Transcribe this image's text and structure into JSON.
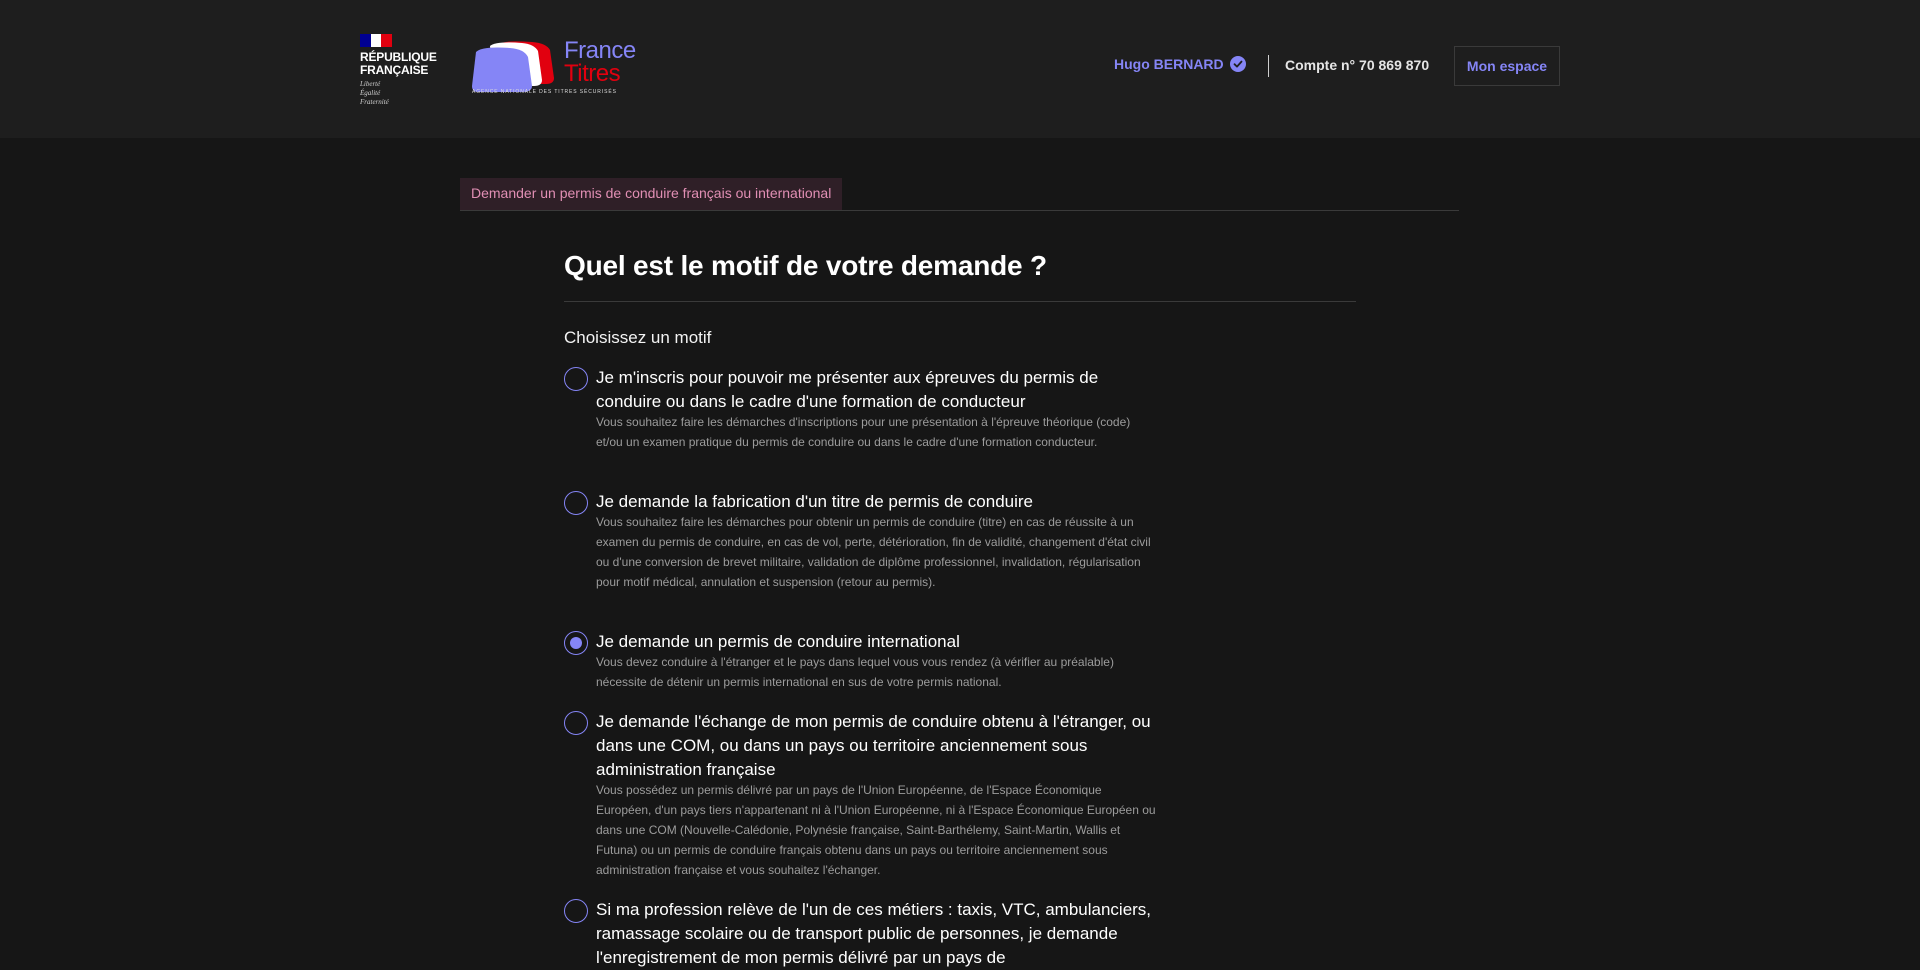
{
  "header": {
    "republique": {
      "line1": "RÉPUBLIQUE",
      "line2": "FRANÇAISE",
      "motto": [
        "Liberté",
        "Égalité",
        "Fraternité"
      ],
      "flag_colors": [
        "#000091",
        "#ffffff",
        "#e1000f"
      ]
    },
    "brand": {
      "line1": "France",
      "line2": "Titres",
      "agency": "AGENCE NATIONALE DES TITRES SÉCURISÉS"
    },
    "user_name": "Hugo BERNARD",
    "verified_icon": "check-badge-icon",
    "account": "Compte n° 70 869 870",
    "mon_espace": "Mon espace"
  },
  "breadcrumb": {
    "label": "Demander un permis de conduire français ou international"
  },
  "form": {
    "title": "Quel est le motif de votre demande ?",
    "legend": "Choisissez un motif",
    "options": [
      {
        "label": "Je m'inscris pour pouvoir me présenter aux épreuves du permis de conduire ou dans le cadre d'une formation de conducteur",
        "hint": "Vous souhaitez faire les démarches d'inscriptions pour une présentation à l'épreuve théorique (code) et/ou un examen pratique du permis de conduire ou dans le cadre d'une formation conducteur.",
        "checked": false
      },
      {
        "label": "Je demande la fabrication d'un titre de permis de conduire",
        "hint": "Vous souhaitez faire les démarches pour obtenir un permis de conduire (titre) en cas de réussite à un examen du permis de conduire, en cas de vol, perte, détérioration, fin de validité, changement d'état civil ou d'une conversion de brevet militaire, validation de diplôme professionnel, invalidation, régularisation pour motif médical, annulation et suspension (retour au permis).",
        "checked": false
      },
      {
        "label": "Je demande un permis de conduire international",
        "hint": "Vous devez conduire à l'étranger et le pays dans lequel vous vous rendez (à vérifier au préalable) nécessite de détenir un permis international en sus de votre permis national.",
        "checked": true
      },
      {
        "label": "Je demande l'échange de mon permis de conduire obtenu à l'étranger, ou dans une COM, ou dans un pays ou territoire anciennement sous administration française",
        "hint": "Vous possédez un permis délivré par un pays de l'Union Européenne, de l'Espace Économique Européen, d'un pays tiers n'appartenant ni à l'Union Européenne, ni à l'Espace Économique Européen ou dans une COM (Nouvelle-Calédonie, Polynésie française, Saint-Barthélemy, Saint-Martin, Wallis et Futuna) ou un permis de conduire français obtenu dans un pays ou territoire anciennement sous administration française et vous souhaitez l'échanger.",
        "checked": false
      },
      {
        "label": "Si ma profession relève de l'un de ces métiers : taxis, VTC, ambulanciers, ramassage scolaire ou de transport public de personnes, je demande l'enregistrement de mon permis délivré par un pays de",
        "hint": "",
        "checked": false
      }
    ]
  },
  "colors": {
    "accent": "#8585f6",
    "background": "#161616",
    "header_background": "#1e1e1e",
    "breadcrumb_text": "#e18fb4",
    "breadcrumb_background": "#2f1f27",
    "hint_text": "#9c9c9c"
  }
}
